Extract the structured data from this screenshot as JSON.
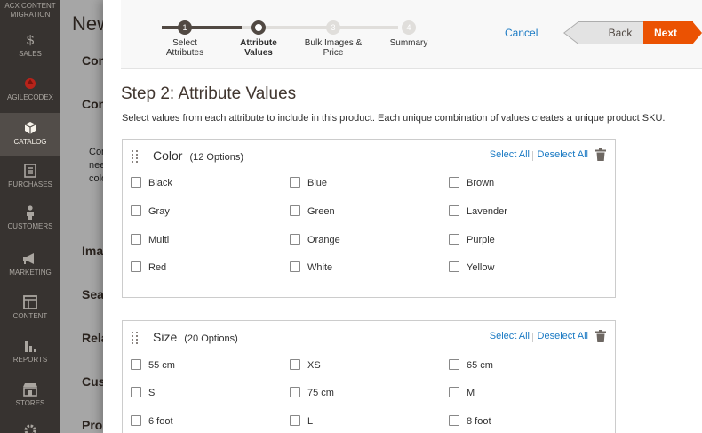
{
  "sidebar": {
    "top_label": "ACX CONTENT MIGRATION",
    "items": [
      {
        "label": "SALES",
        "icon": "dollar-icon"
      },
      {
        "label": "AGILECODEX",
        "icon": "agilecodex-logo-icon"
      },
      {
        "label": "CATALOG",
        "icon": "cube-icon"
      },
      {
        "label": "PURCHASES",
        "icon": "document-icon"
      },
      {
        "label": "CUSTOMERS",
        "icon": "person-icon"
      },
      {
        "label": "MARKETING",
        "icon": "megaphone-icon"
      },
      {
        "label": "CONTENT",
        "icon": "layout-icon"
      },
      {
        "label": "REPORTS",
        "icon": "bar-chart-icon"
      },
      {
        "label": "STORES",
        "icon": "store-icon"
      }
    ]
  },
  "background_page": {
    "title": "New",
    "rows": [
      "Con",
      "Con",
      "Ima",
      "Sea",
      "Rela",
      "Cus",
      "Pro"
    ],
    "text_lines": [
      "Con",
      "nee",
      "colo"
    ]
  },
  "wizard": {
    "steps": [
      {
        "label_line1": "Select",
        "label_line2": "Attributes",
        "number": "1",
        "state": "done"
      },
      {
        "label_line1": "Attribute",
        "label_line2": "Values",
        "number": "2",
        "state": "current"
      },
      {
        "label_line1": "Bulk Images &",
        "label_line2": "Price",
        "number": "3",
        "state": "todo"
      },
      {
        "label_line1": "Summary",
        "label_line2": "",
        "number": "4",
        "state": "todo"
      }
    ],
    "cancel_label": "Cancel",
    "back_label": "Back",
    "next_label": "Next",
    "step_title": "Step 2: Attribute Values",
    "step_description": "Select values from each attribute to include in this product. Each unique combination of values creates a unique product SKU."
  },
  "attributes": [
    {
      "name": "Color",
      "count_label": "(12 Options)",
      "select_all": "Select All",
      "deselect_all": "Deselect All",
      "options": [
        "Black",
        "Blue",
        "Brown",
        "Gray",
        "Green",
        "Lavender",
        "Multi",
        "Orange",
        "Purple",
        "Red",
        "White",
        "Yellow"
      ]
    },
    {
      "name": "Size",
      "count_label": "(20 Options)",
      "select_all": "Select All",
      "deselect_all": "Deselect All",
      "options": [
        "55 cm",
        "XS",
        "65 cm",
        "S",
        "75 cm",
        "M",
        "6 foot",
        "L",
        "8 foot"
      ]
    }
  ],
  "colors": {
    "sidebar_bg": "#373330",
    "accent_orange": "#eb5202",
    "link_blue": "#1979c3",
    "progress_dark": "#514943"
  }
}
